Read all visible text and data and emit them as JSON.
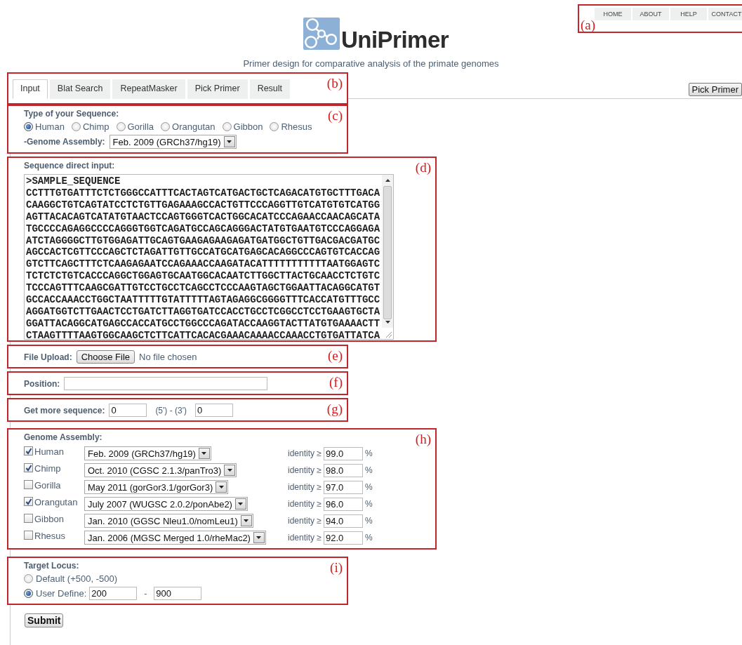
{
  "nav": {
    "items": [
      "HOME",
      "ABOUT",
      "HELP",
      "CONTACT"
    ],
    "callout": "(a)"
  },
  "header": {
    "logo_text": "UniPrimer",
    "subtitle": "Primer design for comparative analysis of the primate genomes"
  },
  "tabs": {
    "items": [
      {
        "label": "Input",
        "selected": true
      },
      {
        "label": "Blat Search",
        "selected": false
      },
      {
        "label": "RepeatMasker",
        "selected": false
      },
      {
        "label": "Pick Primer",
        "selected": false
      },
      {
        "label": "Result",
        "selected": false
      }
    ],
    "callout": "(b)"
  },
  "pick_primer_button": "Pick Primer",
  "sequence_type": {
    "label": "Type of your Sequence:",
    "options": [
      {
        "label": "Human",
        "selected": true
      },
      {
        "label": "Chimp",
        "selected": false
      },
      {
        "label": "Gorilla",
        "selected": false
      },
      {
        "label": "Orangutan",
        "selected": false
      },
      {
        "label": "Gibbon",
        "selected": false
      },
      {
        "label": "Rhesus",
        "selected": false
      }
    ],
    "assembly_label": "-Genome Assembly:",
    "assembly_value": "Feb. 2009 (GRCh37/hg19)",
    "callout": "(c)"
  },
  "sequence_input": {
    "label": "Sequence direct input:",
    "callout": "(d)",
    "lines": [
      ">SAMPLE_SEQUENCE",
      "CCTTTGTGATTTCTCTGGGCCATTTCACTAGTCATGACTGCTCAGACATGTGCTTTGACA",
      "CAAGGCTGTCAGTATCCTCTGTTGAGAAAGCCACTGTTCCCAGGTTGTCATGTGTCATGG",
      "AGTTACACAGTCATATGTAACTCCAGTGGGTCACTGGCACATCCCAGAACCAACAGCATA",
      "TGCCCCAGAGGCCCCAGGGTGGTCAGATGCCAGCAGGGACTATGTGAATGTCCCAGGAGA",
      "ATCTAGGGGCTTGTGGAGATTGCAGTGAAGAGAAGAGATGATGGCTGTTGACGACGATGC",
      "AGCCACTCGTTCCCAGCTCTAGATTGTTGCCATGCATGAGCACAGGCCCAGTGTCACCAG",
      "GTCTTCAGCTTTCTCAAGAGAATCCAGAAACCAAGATACATTTTTTTTTTTAATGGAGTC",
      "TCTCTCTGTCACCCAGGCTGGAGTGCAATGGCACAATCTTGGCTTACTGCAACCTCTGTC",
      "TCCCAGTTTCAAGCGATTGTCCTGCCTCAGCCTCCCAAGTAGCTGGAATTACAGGCATGT",
      "GCCACCAAACCTGGCTAATTTTTGTATTTTTAGTAGAGGCGGGGTTTCACCATGTTTGCC",
      "AGGATGGTCTTGAACTCCTGATCTTAGGTGATCCACCTGCCTCGGCCTCCTGAAGTGCTA",
      "GGATTACAGGCATGAGCCACCATGCCTGGCCCAGATACCAAGGTACTTATGTGAAAACTT",
      "CTAAGTTTTAAGTGGCAAGCTCTTCATTCACACGAAACAAAACCAAACCTGTGATTATCA"
    ]
  },
  "file_upload": {
    "label": "File Upload:",
    "button": "Choose File",
    "status": "No file chosen",
    "callout": "(e)"
  },
  "position": {
    "label": "Position:",
    "callout": "(f)"
  },
  "more_sequence": {
    "label": "Get more sequence:",
    "value_5": "0",
    "separator": "(5') - (3')",
    "value_3": "0",
    "callout": "(g)"
  },
  "genome_assembly": {
    "label": "Genome Assembly:",
    "callout": "(h)",
    "rows": [
      {
        "species": "Human",
        "checked": true,
        "assembly": "Feb. 2009 (GRCh37/hg19)",
        "identity_label": "identity ≥",
        "identity": "99.0",
        "unit": "%"
      },
      {
        "species": "Chimp",
        "checked": true,
        "assembly": "Oct. 2010 (CGSC 2.1.3/panTro3)",
        "identity_label": "identity ≥",
        "identity": "98.0",
        "unit": "%"
      },
      {
        "species": "Gorilla",
        "checked": false,
        "assembly": "May 2011 (gorGor3.1/gorGor3)",
        "identity_label": "identity ≥",
        "identity": "97.0",
        "unit": "%"
      },
      {
        "species": "Orangutan",
        "checked": true,
        "assembly": "July 2007 (WUGSC 2.0.2/ponAbe2)",
        "identity_label": "identity ≥",
        "identity": "96.0",
        "unit": "%"
      },
      {
        "species": "Gibbon",
        "checked": false,
        "assembly": "Jan. 2010 (GGSC Nleu1.0/nomLeu1)",
        "identity_label": "identity ≥",
        "identity": "94.0",
        "unit": "%"
      },
      {
        "species": "Rhesus",
        "checked": false,
        "assembly": "Jan. 2006 (MGSC Merged 1.0/rheMac2)",
        "identity_label": "identity ≥",
        "identity": "92.0",
        "unit": "%"
      }
    ]
  },
  "target_locus": {
    "label": "Target Locus:",
    "callout": "(i)",
    "options": [
      {
        "kind": "plain",
        "label": "Default (+500, -500)",
        "selected": false
      },
      {
        "kind": "range",
        "label": "User Define:",
        "selected": true,
        "from": "200",
        "dash": "-",
        "to": "900"
      }
    ]
  },
  "submit_button": "Submit"
}
